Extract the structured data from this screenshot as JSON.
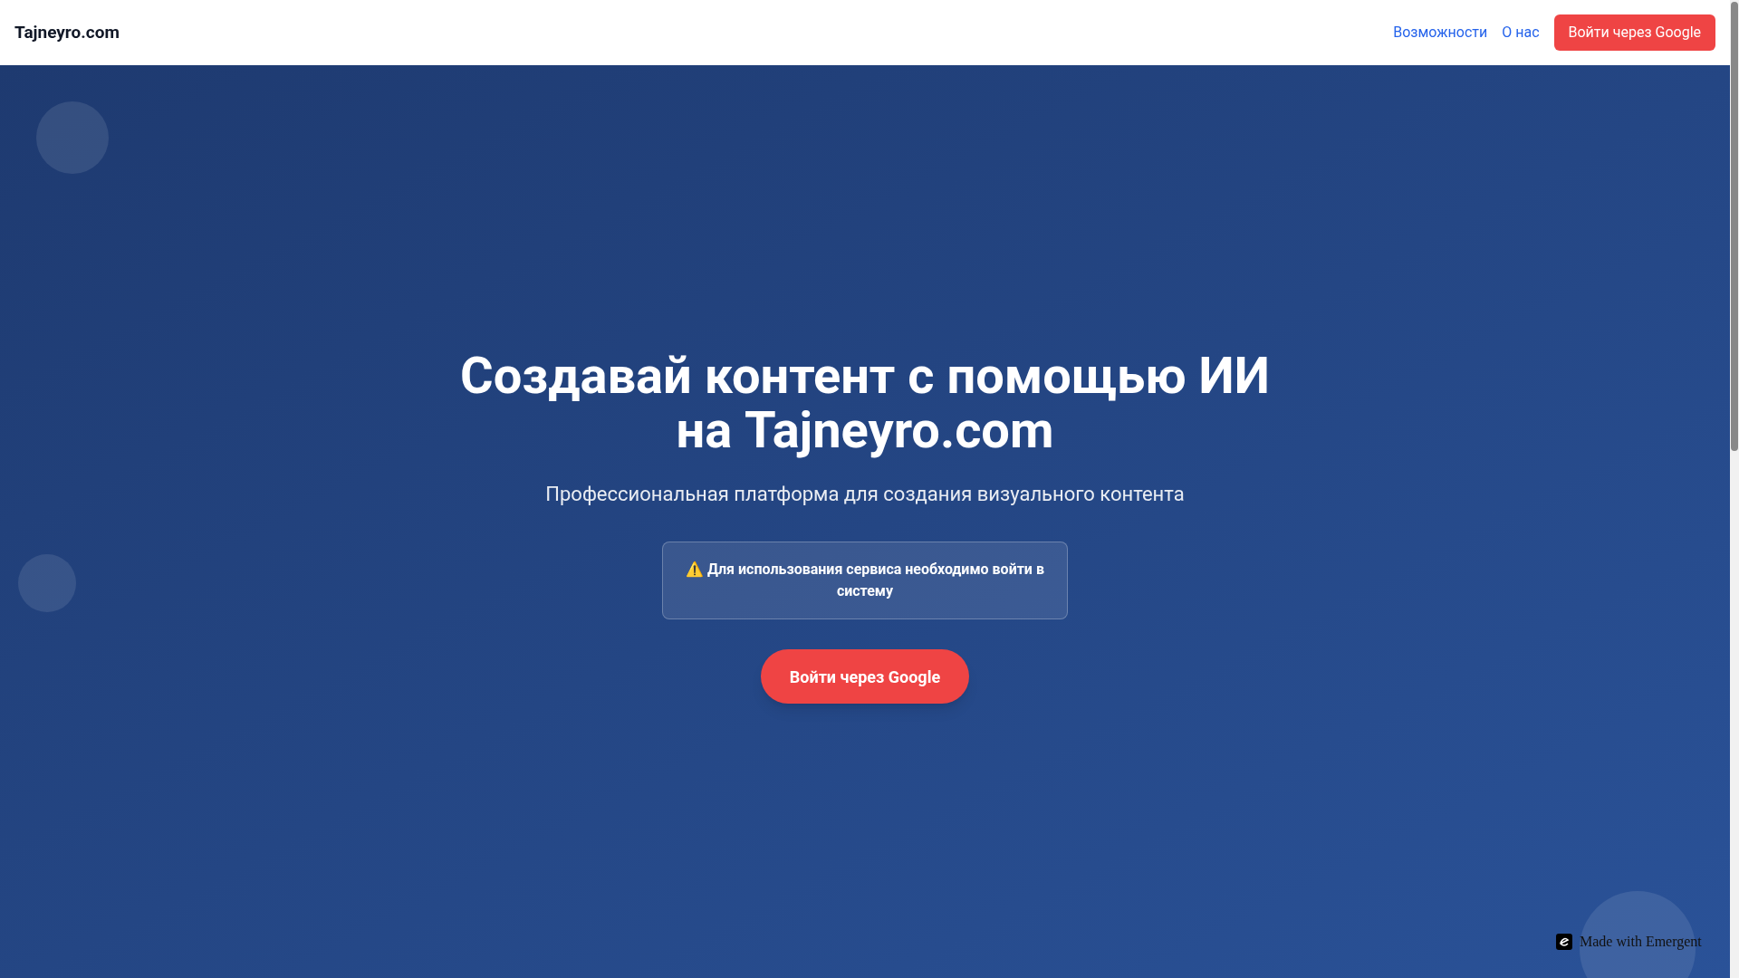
{
  "header": {
    "logo": "Tajneyro.com",
    "nav_links": [
      "Возможности",
      "О нас"
    ],
    "login_button": "Войти через Google"
  },
  "hero": {
    "title_lines": [
      "Создавай контент с помощью ИИ",
      "на Tajneyro.com"
    ],
    "subtitle": "Профессиональная платформа для создания визуального контента",
    "alert": "⚠️ Для использования сервиса необходимо войти в систему",
    "login_button": "Войти через Google"
  },
  "badge": {
    "text": "Made with Emergent"
  }
}
